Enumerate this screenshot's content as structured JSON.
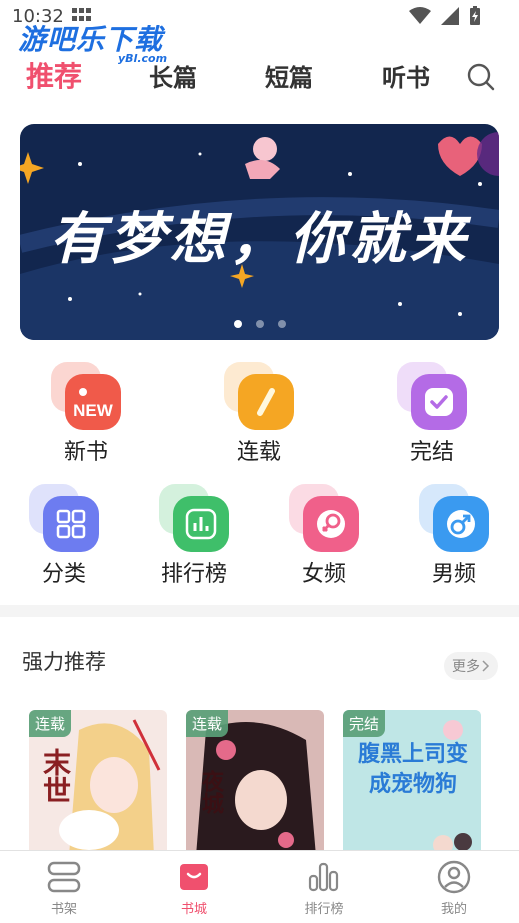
{
  "status": {
    "time": "10:32"
  },
  "watermark": {
    "text": "游吧乐下载",
    "sub": "yBl.com"
  },
  "tabs": [
    {
      "label": "推荐",
      "active": true
    },
    {
      "label": "长篇",
      "active": false
    },
    {
      "label": "短篇",
      "active": false
    },
    {
      "label": "听书",
      "active": false
    }
  ],
  "banner": {
    "text": "有梦想，你就来",
    "slide_count": 3,
    "active_slide": 1
  },
  "categories": [
    {
      "label": "新书",
      "icon": "new-badge-icon",
      "badge_text": "NEW",
      "color": "#f05a4a"
    },
    {
      "label": "连载",
      "icon": "pencil-icon",
      "color": "#f5a623"
    },
    {
      "label": "完结",
      "icon": "check-icon",
      "color": "#b46be6"
    },
    {
      "label": "分类",
      "icon": "grid-icon",
      "color": "#6d7cf0"
    },
    {
      "label": "排行榜",
      "icon": "bar-chart-icon",
      "color": "#3fbf6a"
    },
    {
      "label": "女频",
      "icon": "female-icon",
      "color": "#f0608a"
    },
    {
      "label": "男频",
      "icon": "male-icon",
      "color": "#3a9af0"
    }
  ],
  "section": {
    "title": "强力推荐",
    "more_label": "更多"
  },
  "books": [
    {
      "badge": "连载",
      "cover_text": "末世",
      "bg": "#f6e8e4"
    },
    {
      "badge": "连载",
      "cover_text": "夜城",
      "bg": "#d9b9b6"
    },
    {
      "badge": "完结",
      "cover_text": "腹黑上司变成宠物狗",
      "bg": "#bfe6e6"
    }
  ],
  "bottom_nav": [
    {
      "label": "书架",
      "icon": "bookshelf-icon",
      "active": false
    },
    {
      "label": "书城",
      "icon": "bookstore-icon",
      "active": true
    },
    {
      "label": "排行榜",
      "icon": "ranking-icon",
      "active": false
    },
    {
      "label": "我的",
      "icon": "profile-icon",
      "active": false
    }
  ],
  "colors": {
    "accent": "#f0506e",
    "banner_bg": "#12264e"
  }
}
